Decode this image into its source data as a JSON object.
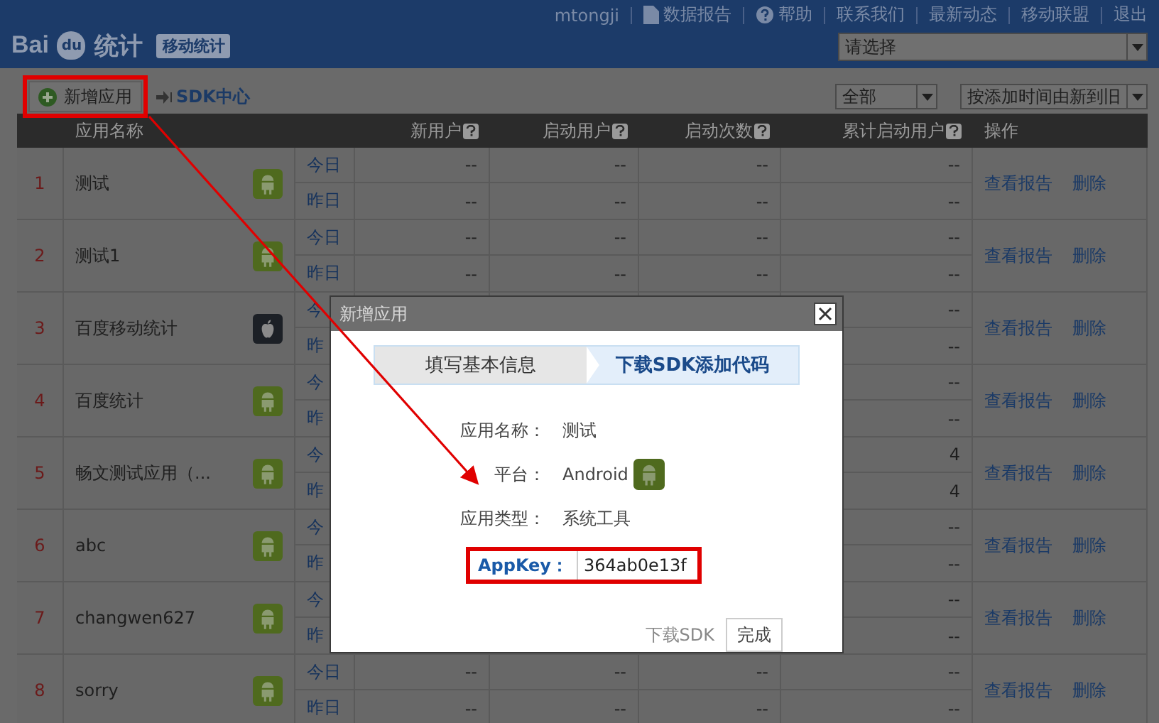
{
  "header": {
    "logo": {
      "part_1": "Bai",
      "part_2": "du",
      "suffix": "统计"
    },
    "product": "移动统计",
    "user": "mtongji",
    "links": [
      {
        "kind": "report",
        "label": "数据报告"
      },
      {
        "kind": "help",
        "label": "帮助"
      },
      {
        "kind": "plain",
        "label": "联系我们"
      },
      {
        "kind": "plain",
        "label": "最新动态"
      },
      {
        "kind": "plain",
        "label": "移动联盟"
      },
      {
        "kind": "plain",
        "label": "退出"
      }
    ],
    "app_select": {
      "placeholder": "请选择"
    }
  },
  "toolbar": {
    "add_button": "新增应用",
    "sdk_link": "SDK中心",
    "filter": "全部",
    "sort": "按添加时间由新到旧"
  },
  "table": {
    "columns": [
      {
        "label": "应用名称"
      },
      {
        "label": "新用户",
        "help": true
      },
      {
        "label": "启动用户",
        "help": true
      },
      {
        "label": "启动次数",
        "help": true
      },
      {
        "label": "累计启动用户",
        "help": true
      },
      {
        "label": "操作"
      }
    ],
    "rows": [
      {
        "index": "1",
        "name": "测试",
        "icon": {
          "kind": "android"
        },
        "periods": [
          {
            "label": "今日",
            "new_users": "--",
            "active_users": "--",
            "launches": "--",
            "total_users": "--"
          },
          {
            "label": "昨日",
            "new_users": "--",
            "active_users": "--",
            "launches": "--",
            "total_users": "--"
          }
        ],
        "actions": [
          "查看报告",
          "删除"
        ]
      },
      {
        "index": "2",
        "name": "测试1",
        "icon": {
          "kind": "android"
        },
        "periods": [
          {
            "label": "今日",
            "new_users": "--",
            "active_users": "--",
            "launches": "--",
            "total_users": "--"
          },
          {
            "label": "昨日",
            "new_users": "--",
            "active_users": "--",
            "launches": "--",
            "total_users": "--"
          }
        ],
        "actions": [
          "查看报告",
          "删除"
        ]
      },
      {
        "index": "3",
        "name": "百度移动统计",
        "icon": {
          "kind": "apple"
        },
        "periods": [
          {
            "label": "今",
            "total_users": "--"
          },
          {
            "label": "昨",
            "total_users": "--"
          }
        ],
        "actions": [
          "查看报告",
          "删除"
        ]
      },
      {
        "index": "4",
        "name": "百度统计",
        "icon": {
          "kind": "android"
        },
        "periods": [
          {
            "label": "今",
            "total_users": "--"
          },
          {
            "label": "昨",
            "total_users": "--"
          }
        ],
        "actions": [
          "查看报告",
          "删除"
        ]
      },
      {
        "index": "5",
        "name": "畅文测试应用（...",
        "icon": {
          "kind": "android"
        },
        "periods": [
          {
            "label": "今",
            "total_users": "4"
          },
          {
            "label": "昨",
            "total_users": "4"
          }
        ],
        "actions": [
          "查看报告",
          "删除"
        ]
      },
      {
        "index": "6",
        "name": "abc",
        "icon": {
          "kind": "android"
        },
        "periods": [
          {
            "label": "今",
            "total_users": "--"
          },
          {
            "label": "昨",
            "total_users": "--"
          }
        ],
        "actions": [
          "查看报告",
          "删除"
        ]
      },
      {
        "index": "7",
        "name": "changwen627",
        "icon": {
          "kind": "android"
        },
        "periods": [
          {
            "label": "今",
            "total_users": "--"
          },
          {
            "label": "昨",
            "total_users": "--"
          }
        ],
        "actions": [
          "查看报告",
          "删除"
        ]
      },
      {
        "index": "8",
        "name": "sorry",
        "icon": {
          "kind": "android"
        },
        "periods": [
          {
            "label": "今日",
            "new_users": "--",
            "active_users": "--",
            "launches": "--",
            "total_users": "--"
          },
          {
            "label": "昨日",
            "new_users": "--",
            "active_users": "--",
            "launches": "--",
            "total_users": "--"
          }
        ],
        "actions": [
          "查看报告",
          "删除"
        ]
      }
    ]
  },
  "dialog": {
    "title": "新增应用",
    "steps": [
      {
        "label": "填写基本信息",
        "selected": false
      },
      {
        "label": "下载SDK添加代码",
        "selected": true
      }
    ],
    "fields": [
      {
        "kind": "text",
        "label": "应用名称：",
        "value": "测试"
      },
      {
        "kind": "platform",
        "label": "平台：",
        "value": "Android",
        "icon": {
          "kind": "android"
        }
      },
      {
        "kind": "text",
        "label": "应用类型：",
        "value": "系统工具"
      },
      {
        "kind": "key",
        "label": "AppKey：",
        "value": "364ab0e13f"
      }
    ],
    "download_link": "下载SDK",
    "done_button": "完成"
  }
}
